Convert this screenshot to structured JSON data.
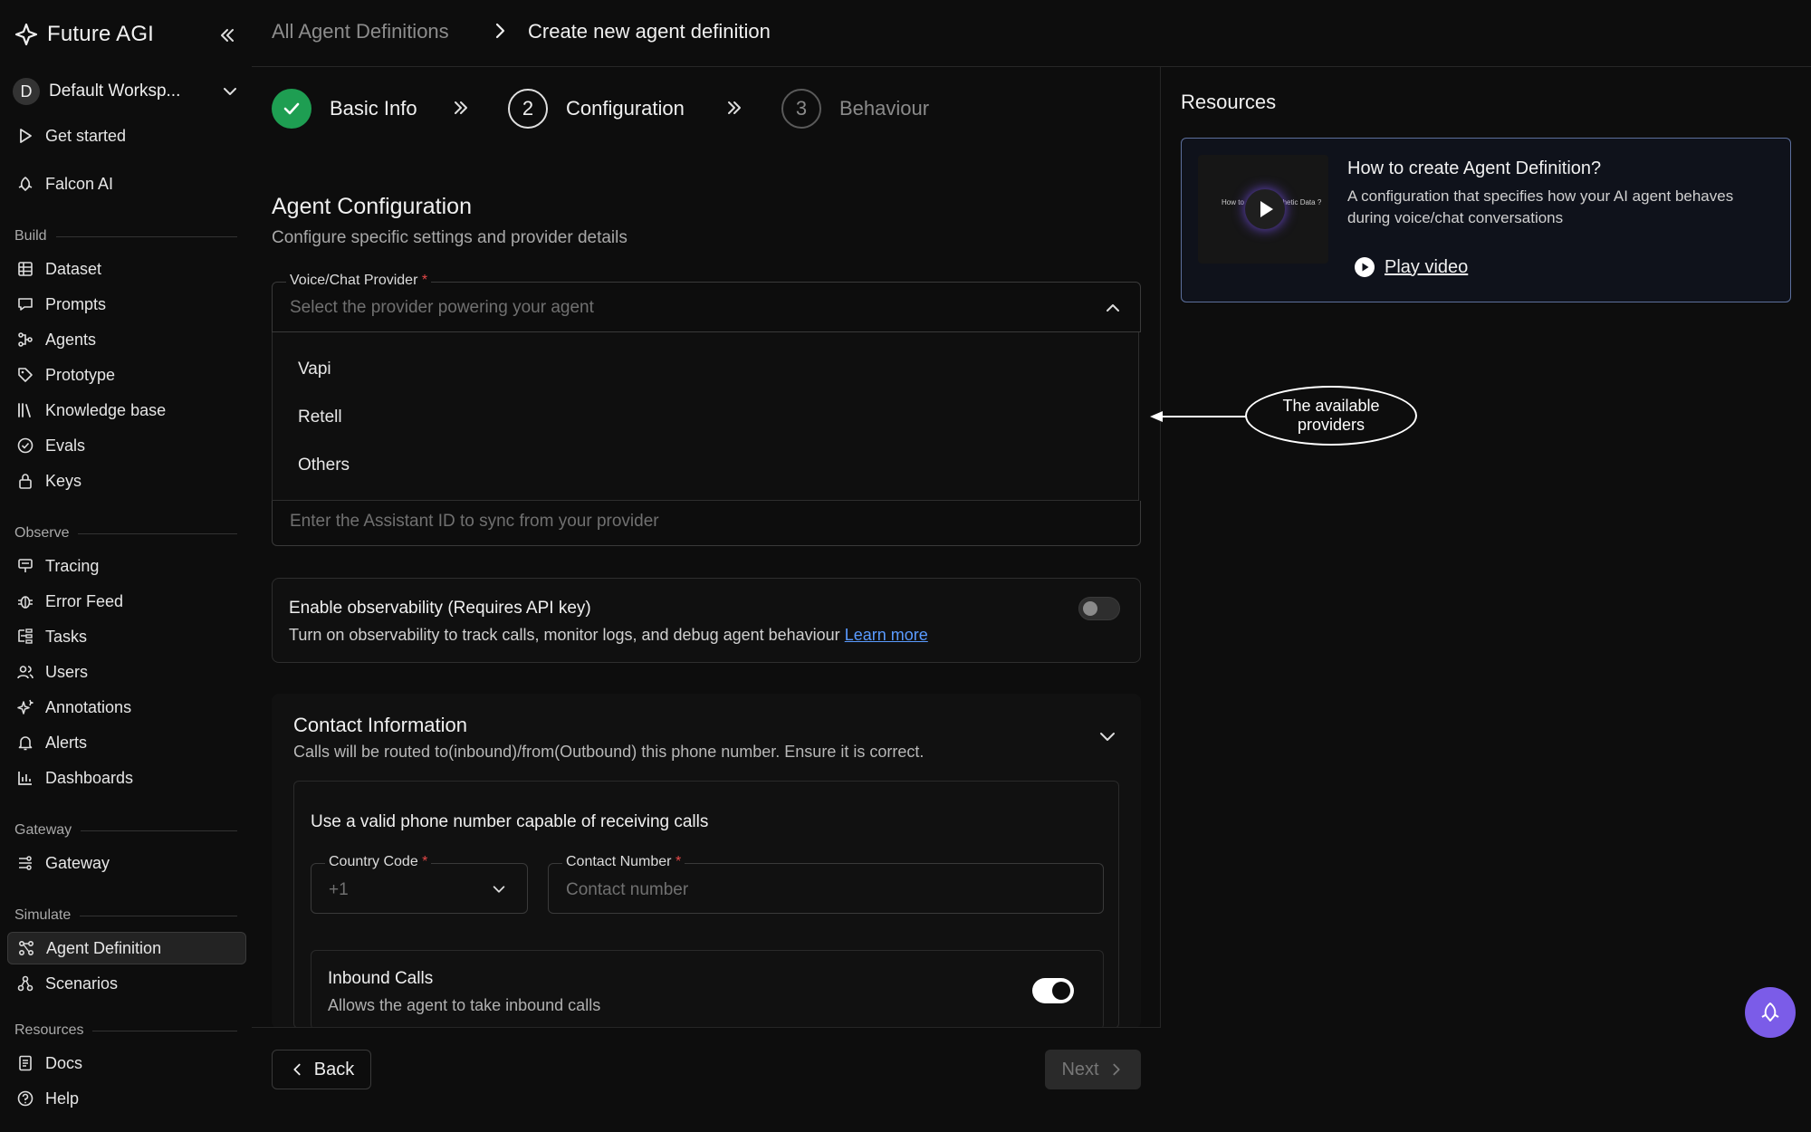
{
  "brand": {
    "name": "Future AGI"
  },
  "workspace": {
    "initial": "D",
    "name": "Default Worksp..."
  },
  "sidebar": {
    "top_items": [
      {
        "label": "Get started",
        "icon": "play-icon"
      },
      {
        "label": "Falcon AI",
        "icon": "falcon-icon"
      }
    ],
    "sections": {
      "build": "Build",
      "observe": "Observe",
      "gateway": "Gateway",
      "simulate": "Simulate",
      "resources": "Resources"
    },
    "build_items": [
      "Dataset",
      "Prompts",
      "Agents",
      "Prototype",
      "Knowledge base",
      "Evals",
      "Keys"
    ],
    "observe_items": [
      "Tracing",
      "Error Feed",
      "Tasks",
      "Users",
      "Annotations",
      "Alerts",
      "Dashboards"
    ],
    "gateway_items": [
      "Gateway"
    ],
    "simulate_items": [
      "Agent Definition",
      "Scenarios"
    ],
    "resources_items": [
      "Docs",
      "Help"
    ]
  },
  "breadcrumb": {
    "parent": "All Agent Definitions",
    "current": "Create new agent definition"
  },
  "stepper": {
    "steps": [
      {
        "label": "Basic Info",
        "number": "",
        "state": "done"
      },
      {
        "label": "Configuration",
        "number": "2",
        "state": "current"
      },
      {
        "label": "Behaviour",
        "number": "3",
        "state": "future"
      }
    ]
  },
  "config": {
    "title": "Agent Configuration",
    "subtitle": "Configure specific settings and provider details",
    "provider_label": "Voice/Chat Provider",
    "required_mark": "*",
    "provider_placeholder": "Select the provider powering your agent",
    "provider_options": [
      "Vapi",
      "Retell",
      "Others"
    ],
    "assistant_placeholder": "Enter the Assistant ID to sync from your provider"
  },
  "observability": {
    "title": "Enable observability (Requires API key)",
    "desc": "Turn on observability to track calls, monitor logs, and debug agent behaviour",
    "link": "Learn more",
    "enabled": false
  },
  "contact": {
    "title": "Contact Information",
    "desc": "Calls will be routed to(inbound)/from(Outbound) this phone number. Ensure it is correct.",
    "inner_title": "Use a valid phone number capable of receiving calls",
    "country_label": "Country Code",
    "country_value": "+1",
    "number_label": "Contact Number",
    "number_placeholder": "Contact number",
    "inbound_title": "Inbound Calls",
    "inbound_desc": "Allows the agent to take inbound calls",
    "inbound_enabled": true
  },
  "footer": {
    "back": "Back",
    "next": "Next"
  },
  "resources": {
    "title": "Resources",
    "card_title": "How to create Agent Definition?",
    "card_desc": "A configuration that specifies how your AI agent behaves during voice/chat conversations",
    "play_label": "Play video",
    "thumb_text": "How to create Synthetic Data ?"
  },
  "annotation": {
    "text_line1": "The available",
    "text_line2": "providers"
  },
  "colors": {
    "accent_green": "#1e9e52",
    "link_blue": "#5a9bff",
    "fab_purple": "#7b5ce8",
    "required_red": "#e54848"
  }
}
